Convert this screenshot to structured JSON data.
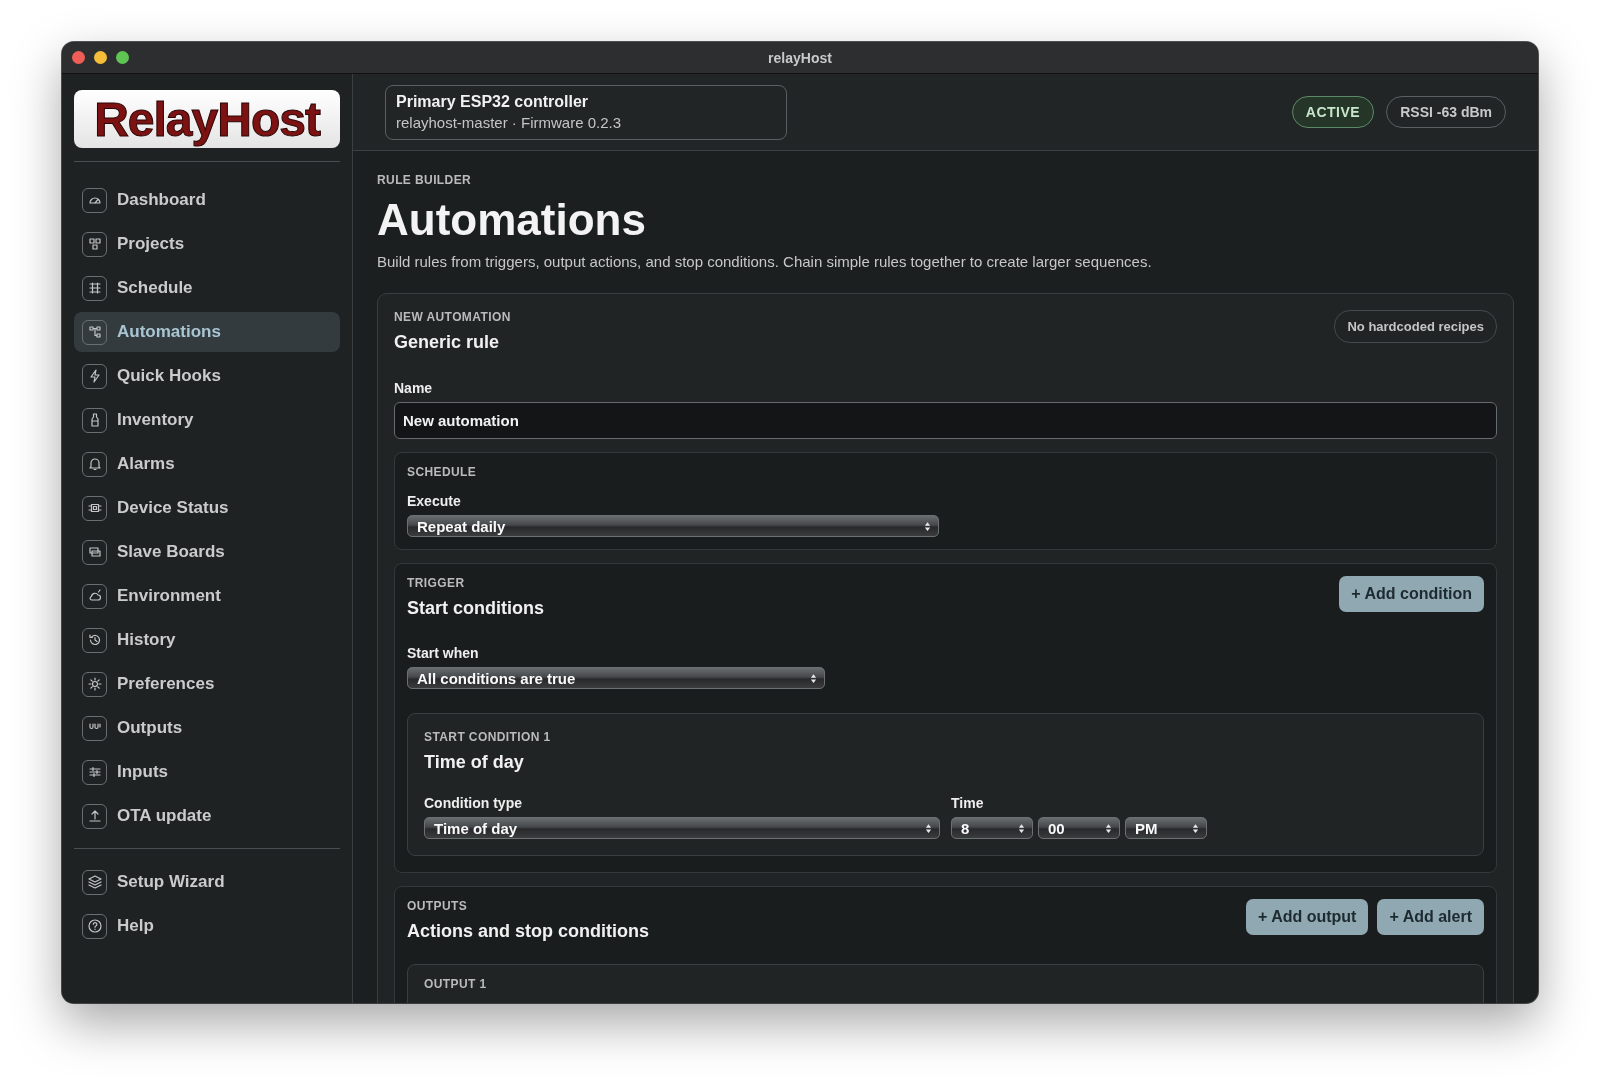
{
  "window": {
    "title": "relayHost"
  },
  "sidebar": {
    "logo": "RelayHost",
    "items": [
      {
        "label": "Dashboard",
        "selected": false
      },
      {
        "label": "Projects",
        "selected": false
      },
      {
        "label": "Schedule",
        "selected": false
      },
      {
        "label": "Automations",
        "selected": true
      },
      {
        "label": "Quick Hooks",
        "selected": false
      },
      {
        "label": "Inventory",
        "selected": false
      },
      {
        "label": "Alarms",
        "selected": false
      },
      {
        "label": "Device Status",
        "selected": false
      },
      {
        "label": "Slave Boards",
        "selected": false
      },
      {
        "label": "Environment",
        "selected": false
      },
      {
        "label": "History",
        "selected": false
      },
      {
        "label": "Preferences",
        "selected": false
      },
      {
        "label": "Outputs",
        "selected": false
      },
      {
        "label": "Inputs",
        "selected": false
      },
      {
        "label": "OTA update",
        "selected": false
      }
    ],
    "footer_items": [
      {
        "label": "Setup Wizard",
        "selected": false
      },
      {
        "label": "Help",
        "selected": false
      }
    ]
  },
  "header": {
    "device_name": "Primary ESP32 controller",
    "device_meta": "relayhost-master · Firmware 0.2.3",
    "status": "ACTIVE",
    "signal": "RSSI -63 dBm"
  },
  "page": {
    "eyebrow": "RULE BUILDER",
    "title": "Automations",
    "description": "Build rules from triggers, output actions, and stop conditions. Chain simple rules together to create larger sequences."
  },
  "automation": {
    "eyebrow": "NEW AUTOMATION",
    "title": "Generic rule",
    "tag": "No hardcoded recipes",
    "name_label": "Name",
    "name_value": "New automation",
    "schedule": {
      "eyebrow": "SCHEDULE",
      "execute_label": "Execute",
      "execute_value": "Repeat daily"
    },
    "trigger": {
      "eyebrow": "TRIGGER",
      "title": "Start conditions",
      "add_button": "+ Add condition",
      "start_when_label": "Start when",
      "start_when_value": "All conditions are true",
      "conditions": [
        {
          "eyebrow": "START CONDITION 1",
          "title": "Time of day",
          "type_label": "Condition type",
          "type_value": "Time of day",
          "time_label": "Time",
          "hour": "8",
          "minute": "00",
          "period": "PM"
        }
      ]
    },
    "outputs": {
      "eyebrow": "OUTPUTS",
      "title": "Actions and stop conditions",
      "buttons": [
        "+ Add output",
        "+ Add alert"
      ],
      "items": [
        {
          "eyebrow": "OUTPUT 1"
        }
      ]
    }
  }
}
